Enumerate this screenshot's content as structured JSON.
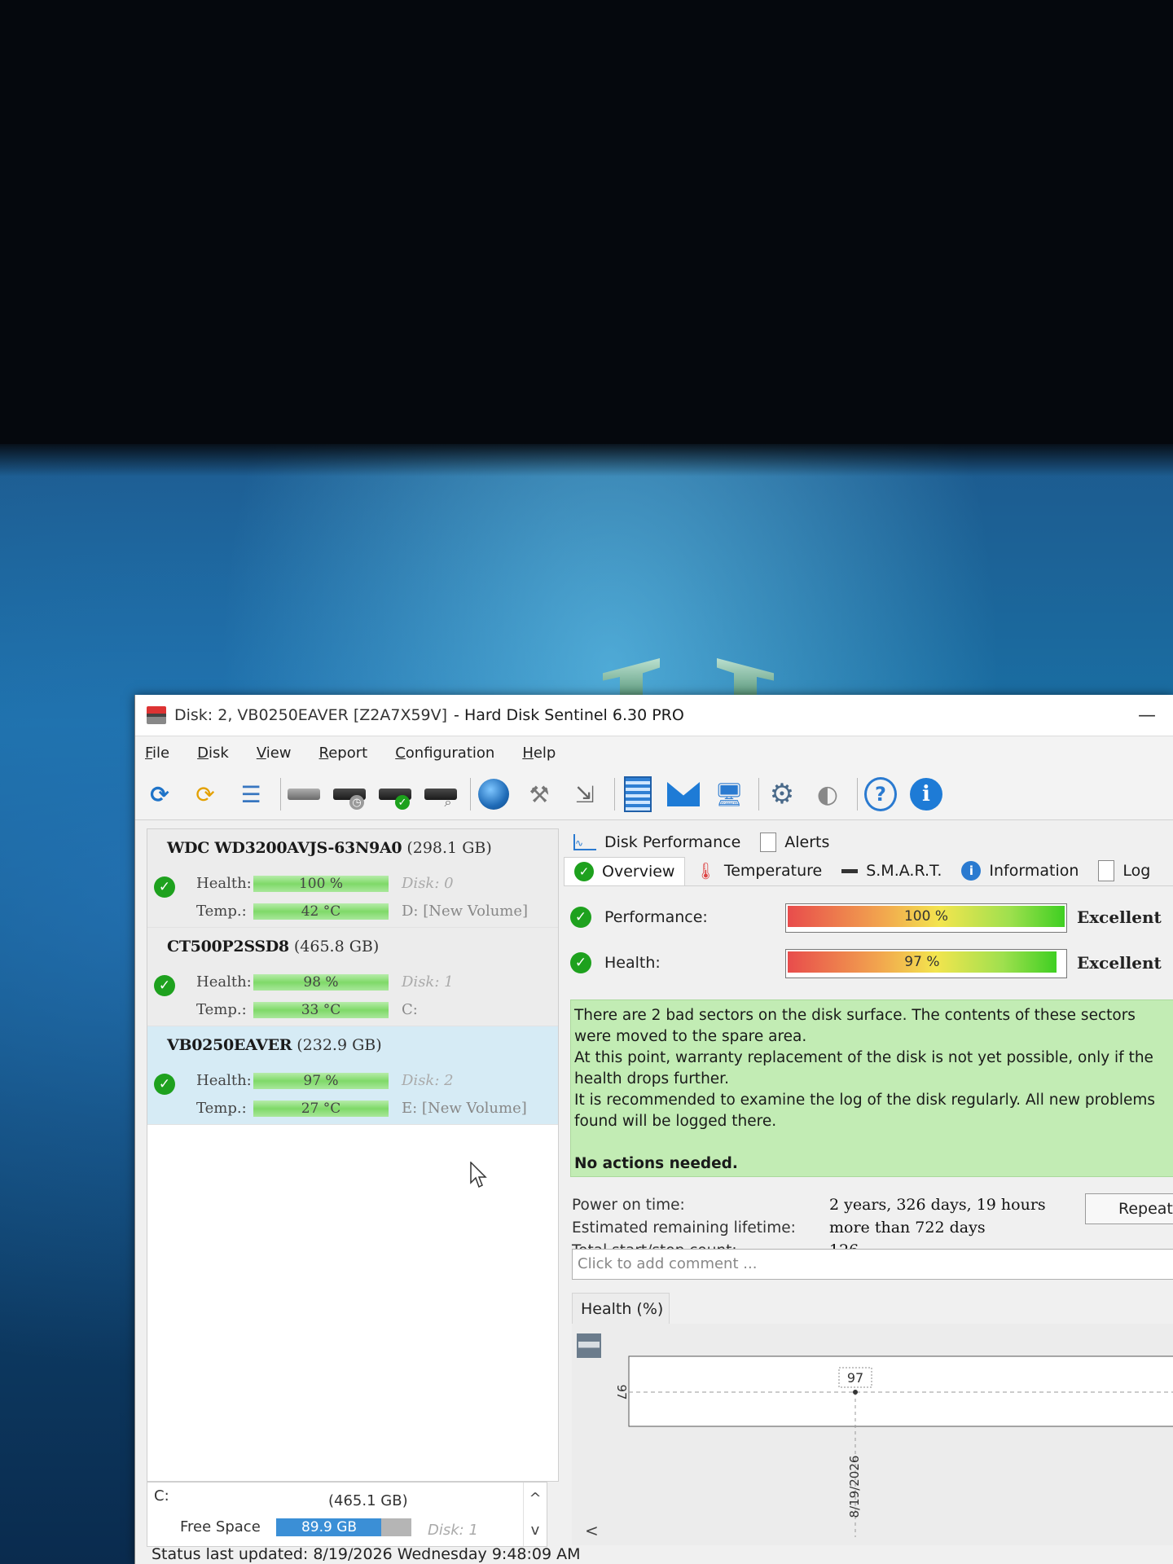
{
  "window": {
    "title_disk": "Disk: 2, VB0250EAVER [Z2A7X59V]",
    "title_app": "-  Hard Disk Sentinel 6.30 PRO",
    "minimize": "—"
  },
  "menu": [
    "File",
    "Disk",
    "View",
    "Report",
    "Configuration",
    "Help"
  ],
  "icons": {
    "refresh": "refresh-icon",
    "refresh_warn": "refresh-warning-icon",
    "list": "list-icon",
    "help": "?",
    "info": "i"
  },
  "disks": [
    {
      "model": "WDC WD3200AVJS-63N9A0",
      "size": "(298.1 GB)",
      "health_label": "Health:",
      "health": "100 %",
      "temp_label": "Temp.:",
      "temp": "42 °C",
      "disk_index": "Disk: 0",
      "volume": "D: [New Volume]"
    },
    {
      "model": "CT500P2SSD8",
      "size": "(465.8 GB)",
      "health_label": "Health:",
      "health": "98 %",
      "temp_label": "Temp.:",
      "temp": "33 °C",
      "disk_index": "Disk: 1",
      "volume": "C:"
    },
    {
      "model": "VB0250EAVER",
      "size": "(232.9 GB)",
      "health_label": "Health:",
      "health": "97 %",
      "temp_label": "Temp.:",
      "temp": "27 °C",
      "disk_index": "Disk: 2",
      "volume": "E: [New Volume]"
    }
  ],
  "partition": {
    "letter": "C:",
    "size": "(465.1 GB)",
    "free_label": "Free Space",
    "free_value": "89.9 GB",
    "free_fraction": 0.78,
    "disk": "Disk: 1",
    "scroll_up": "^",
    "scroll_down": "v"
  },
  "status_bar": "Status last updated: 8/19/2026 Wednesday 9:48:09 AM",
  "tabs": {
    "row1": [
      "Disk Performance",
      "Alerts"
    ],
    "row2": [
      "Overview",
      "Temperature",
      "S.M.A.R.T.",
      "Information",
      "Log"
    ]
  },
  "overview": {
    "performance_label": "Performance:",
    "performance_value": "100 %",
    "performance_percent": 100,
    "performance_word": "Excellent",
    "health_label": "Health:",
    "health_value": "97 %",
    "health_percent": 97,
    "health_word": "Excellent",
    "message": [
      "There are 2 bad sectors on the disk surface. The contents of these sectors were moved to the spare area.",
      "At this point, warranty replacement of the disk is not yet possible, only if the health drops further.",
      "It is recommended to examine the log of the disk regularly. All new problems found will be logged there."
    ],
    "message_final": "No actions needed.",
    "power_on_label": "Power on time:",
    "power_on_value": "2 years, 326 days, 19 hours",
    "remaining_label": "Estimated remaining lifetime:",
    "remaining_value": "more than 722 days",
    "startstop_label": "Total start/stop count:",
    "startstop_value": "126",
    "repeat_button": "Repeat Test",
    "comment_placeholder": "Click to add comment ...",
    "health_tab": "Health (%)"
  },
  "chart_data": {
    "type": "line",
    "x": [
      "8/19/2026"
    ],
    "series": [
      {
        "values": [
          97
        ]
      }
    ],
    "ylabel": "",
    "yticks": [
      "97"
    ],
    "data_labels": [
      "97"
    ],
    "grid": true
  }
}
